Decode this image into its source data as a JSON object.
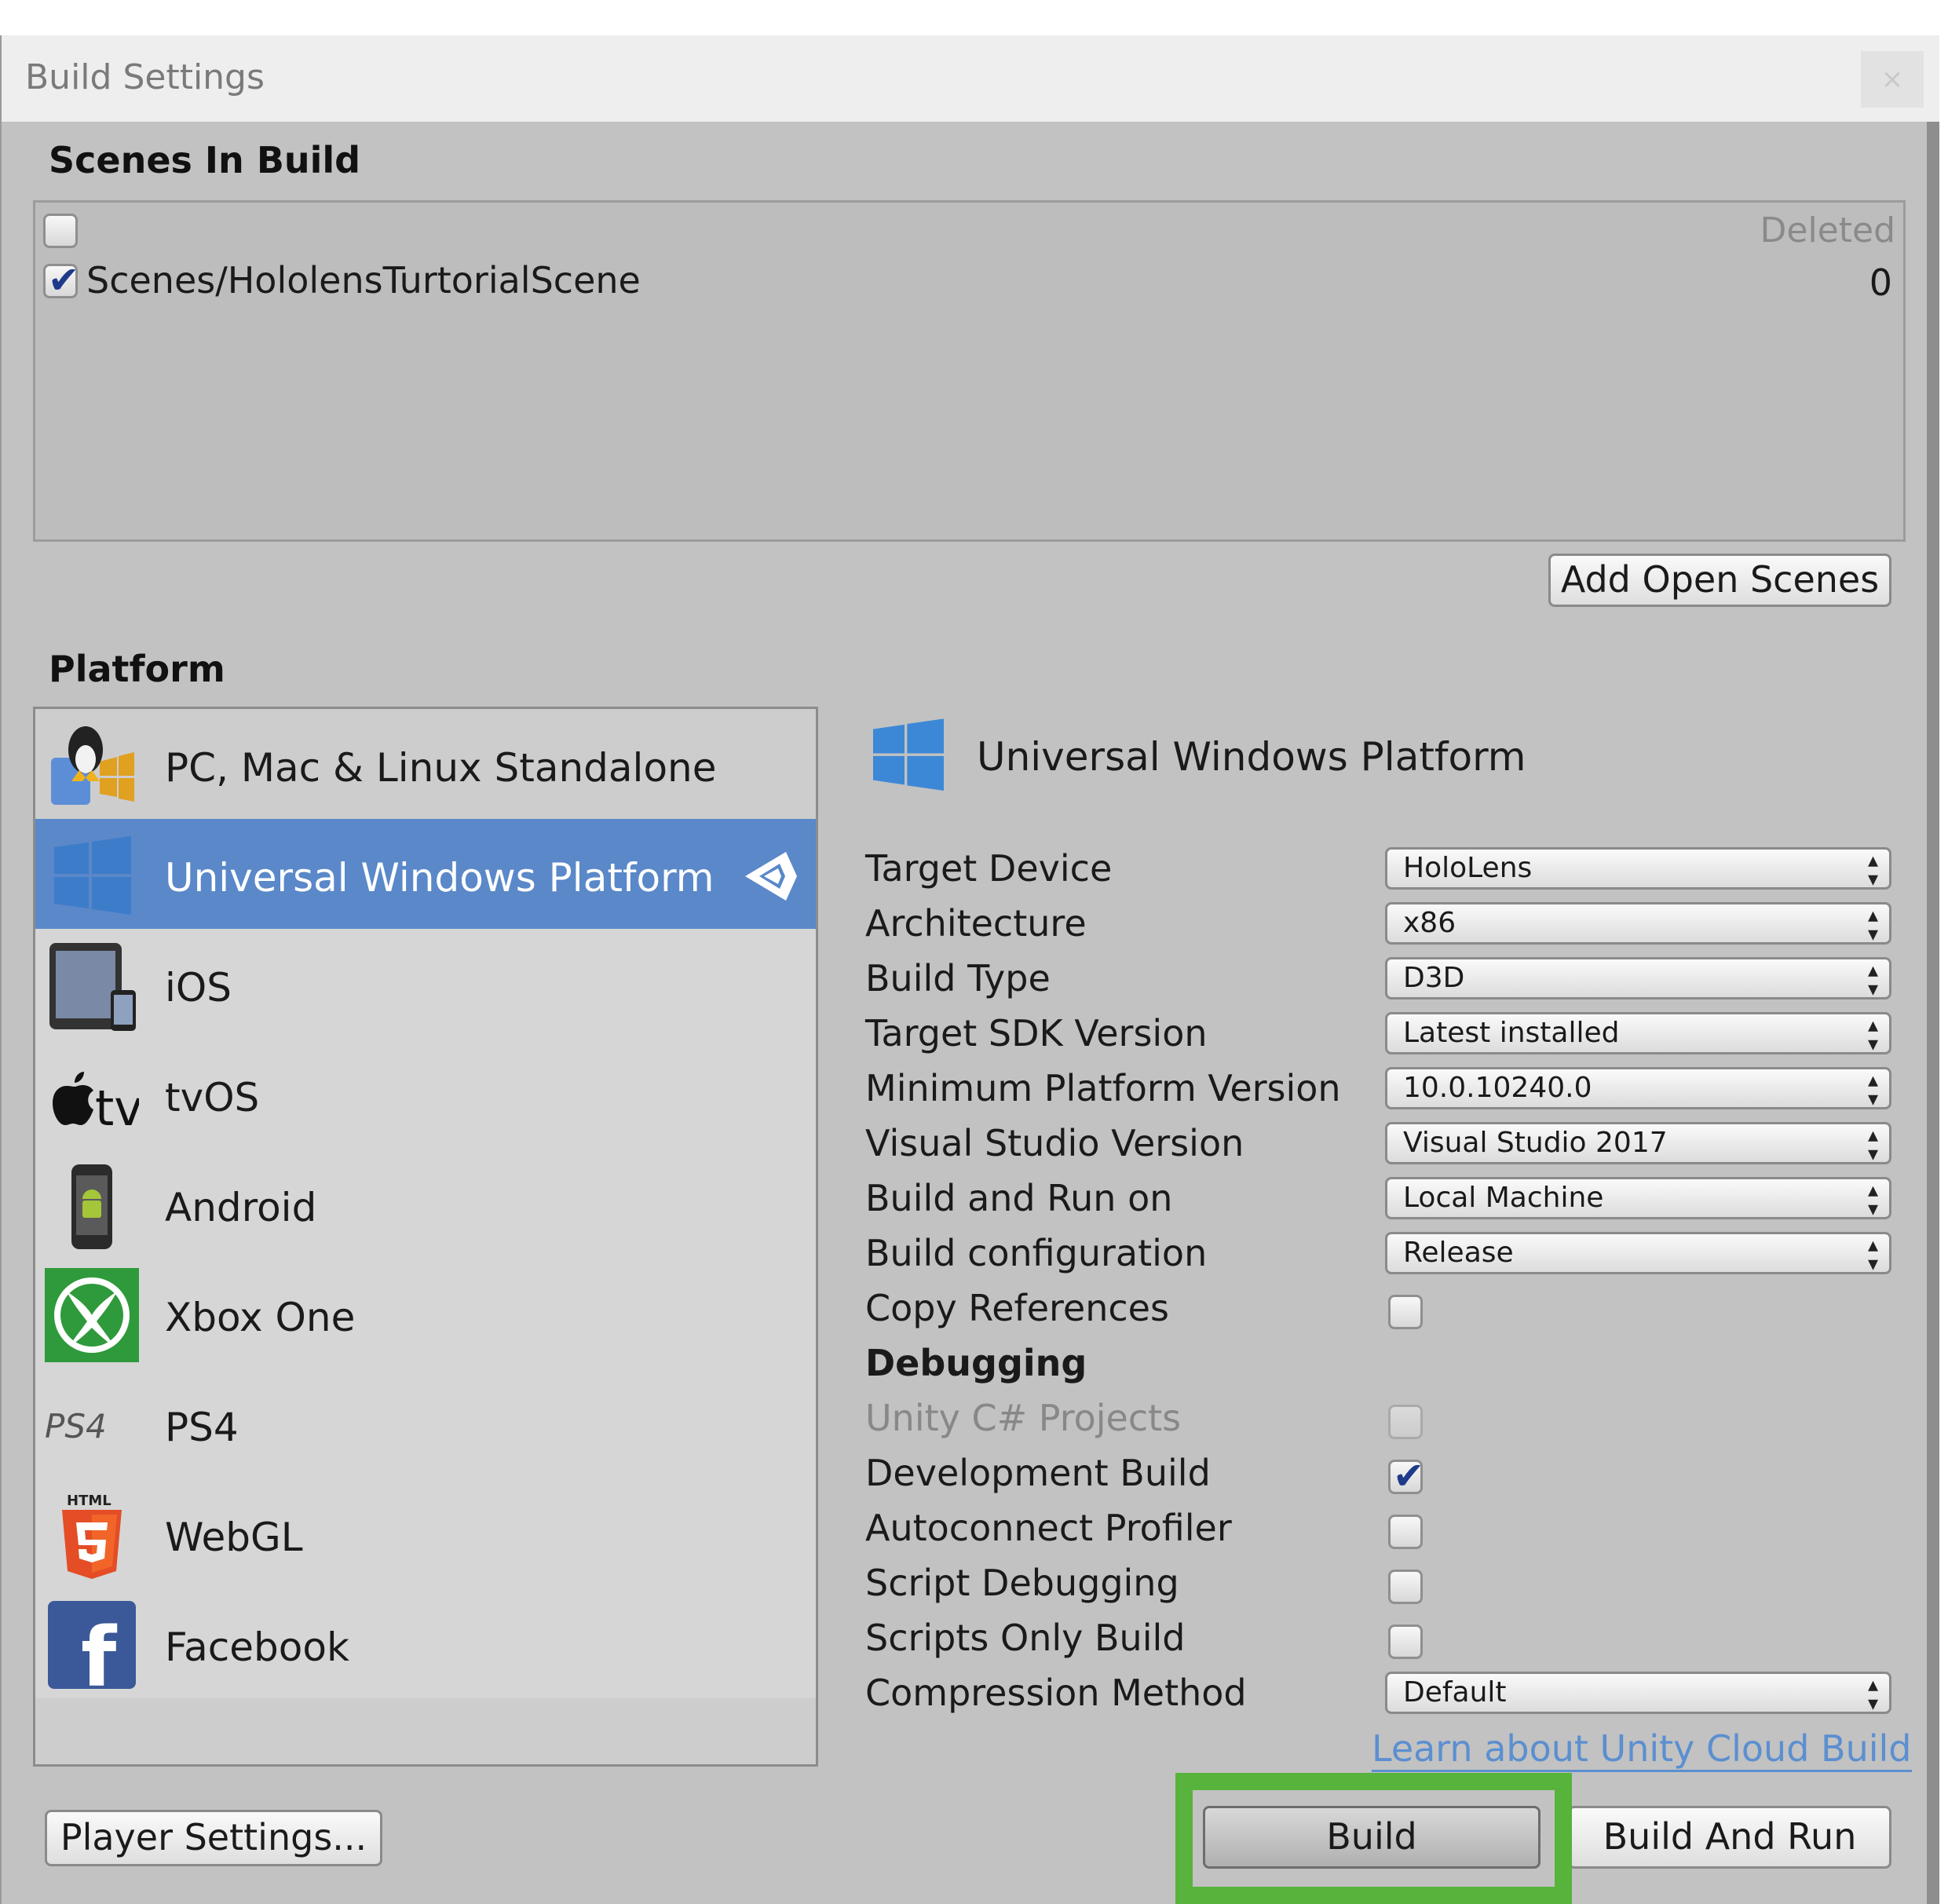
{
  "window": {
    "title": "Build Settings",
    "close": "×"
  },
  "scenes": {
    "heading": "Scenes In Build",
    "deleted_label": "Deleted",
    "items": [
      {
        "path": "Scenes/HololensTurtorialScene",
        "index": "0",
        "checked": true
      }
    ],
    "add_button": "Add Open Scenes"
  },
  "platform": {
    "heading": "Platform",
    "items": [
      {
        "label": "PC, Mac & Linux Standalone",
        "icon": "standalone-icon"
      },
      {
        "label": "Universal Windows Platform",
        "icon": "windows-icon",
        "selected": true
      },
      {
        "label": "iOS",
        "icon": "ios-icon"
      },
      {
        "label": "tvOS",
        "icon": "tvos-icon",
        "icon_text": "tv"
      },
      {
        "label": "Android",
        "icon": "android-icon"
      },
      {
        "label": "Xbox One",
        "icon": "xbox-icon"
      },
      {
        "label": "PS4",
        "icon": "ps4-icon",
        "icon_text": "PS4"
      },
      {
        "label": "WebGL",
        "icon": "html5-icon",
        "icon_text": "HTML"
      },
      {
        "label": "Facebook",
        "icon": "facebook-icon",
        "icon_text": "f"
      }
    ],
    "selected_title": "Universal Windows Platform"
  },
  "settings": {
    "target_device": {
      "label": "Target Device",
      "value": "HoloLens"
    },
    "architecture": {
      "label": "Architecture",
      "value": "x86"
    },
    "build_type": {
      "label": "Build Type",
      "value": "D3D"
    },
    "target_sdk": {
      "label": "Target SDK Version",
      "value": "Latest installed"
    },
    "min_platform": {
      "label": "Minimum Platform Version",
      "value": "10.0.10240.0"
    },
    "vs_version": {
      "label": "Visual Studio Version",
      "value": "Visual Studio 2017"
    },
    "build_run_on": {
      "label": "Build and Run on",
      "value": "Local Machine"
    },
    "build_config": {
      "label": "Build configuration",
      "value": "Release"
    },
    "copy_references": {
      "label": "Copy References",
      "checked": false
    },
    "debugging_heading": "Debugging",
    "unity_csharp": {
      "label": "Unity C# Projects",
      "checked": false,
      "disabled": true
    },
    "development_build": {
      "label": "Development Build",
      "checked": true
    },
    "autoconnect_profiler": {
      "label": "Autoconnect Profiler",
      "checked": false
    },
    "script_debugging": {
      "label": "Script Debugging",
      "checked": false
    },
    "scripts_only_build": {
      "label": "Scripts Only Build",
      "checked": false
    },
    "compression": {
      "label": "Compression Method",
      "value": "Default"
    },
    "cloud_link": "Learn about Unity Cloud Build"
  },
  "buttons": {
    "player_settings": "Player Settings...",
    "build": "Build",
    "build_and_run": "Build And Run"
  },
  "colors": {
    "selection": "#5a88c9",
    "highlight": "#57b33b",
    "link": "#5b8fd0"
  }
}
